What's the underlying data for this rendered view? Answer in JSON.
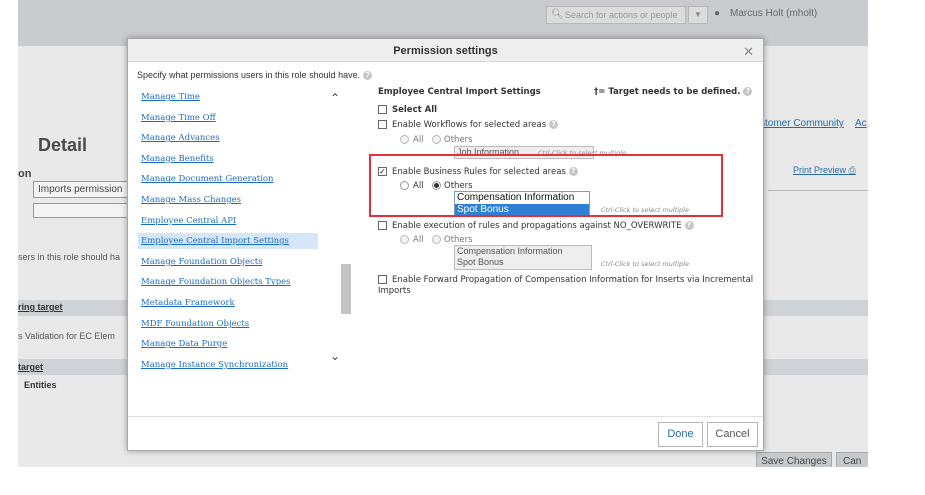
{
  "background": {
    "search_placeholder": "Search for actions or people",
    "user_name": "Marcus Holt (mholt)",
    "page_title": "Detail",
    "section_label": "on",
    "role_name": "Imports permission",
    "should_have_text": "sers in this role should ha",
    "target1": "ring target",
    "validation_text": "s Validation for EC Elem",
    "target2": "target",
    "entities": "Entities",
    "customer_community": "stomer Community",
    "ac_link": "Ac",
    "print_preview": "Print Preview",
    "save_changes": "Save Changes",
    "cancel_partial": "Can"
  },
  "modal": {
    "title": "Permission settings",
    "instruction": "Specify what permissions users in this role should have.",
    "permissions": [
      {
        "label": "Manage Time",
        "selected": false
      },
      {
        "label": "Manage Time Off",
        "selected": false
      },
      {
        "label": "Manage Advances",
        "selected": false
      },
      {
        "label": "Manage Benefits",
        "selected": false
      },
      {
        "label": "Manage Document Generation",
        "selected": false
      },
      {
        "label": "Manage Mass Changes",
        "selected": false
      },
      {
        "label": "Employee Central API",
        "selected": false
      },
      {
        "label": "Employee Central Import Settings",
        "selected": true
      },
      {
        "label": "Manage Foundation Objects",
        "selected": false
      },
      {
        "label": "Manage Foundation Objects Types",
        "selected": false
      },
      {
        "label": "Metadata Framework",
        "selected": false
      },
      {
        "label": "MDF Foundation Objects",
        "selected": false
      },
      {
        "label": "Manage Data Purge",
        "selected": false
      },
      {
        "label": "Manage Instance Synchronization",
        "selected": false
      }
    ],
    "settings": {
      "title": "Employee Central Import Settings",
      "target_note": "†= Target needs to be defined.",
      "select_all": "Select All",
      "workflows": {
        "label": "Enable Workflows for selected areas",
        "checked": false,
        "all": "All",
        "others": "Others",
        "options": [
          "Job Information"
        ],
        "hint": "Ctrl-Click to select multiple"
      },
      "business_rules": {
        "label": "Enable Business Rules for selected areas",
        "checked": true,
        "all": "All",
        "others": "Others",
        "options": [
          "Compensation Information",
          "Spot Bonus"
        ],
        "selected_option": "Spot Bonus",
        "hint": "Ctrl-Click to select multiple"
      },
      "overwrite": {
        "label": "Enable execution of rules and propagations against NO_OVERWRITE",
        "checked": false,
        "all": "All",
        "others": "Others",
        "options": [
          "Compensation Information",
          "Spot Bonus"
        ],
        "hint": "Ctrl-Click to select multiple"
      },
      "forward": {
        "label_line1": "Enable Forward Propagation of Compensation Information for Inserts via Incremental",
        "label_line2": "Imports",
        "checked": false
      }
    },
    "done_label": "Done",
    "cancel_label": "Cancel"
  },
  "colors": {
    "link_blue": "#1c6dbf",
    "selected_item_bg": "#d5e6f6",
    "highlight_red": "#e5303a",
    "option_selected": "#2f7fd5"
  }
}
